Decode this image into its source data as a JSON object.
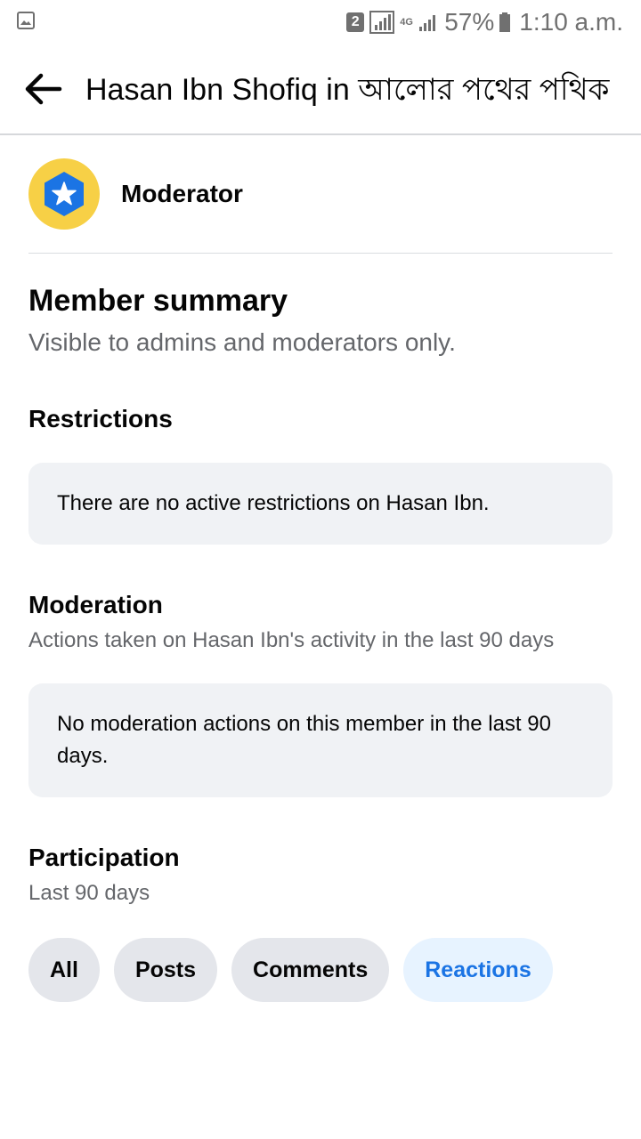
{
  "status_bar": {
    "sim_slot": "2",
    "network_type": "4G",
    "battery_percent": "57%",
    "time": "1:10 a.m."
  },
  "header": {
    "title": "Hasan Ibn Shofiq in আলোর পথের পথিক"
  },
  "role": {
    "label": "Moderator",
    "badge_color": "#f7d046",
    "badge_icon_color": "#1b74e4"
  },
  "summary": {
    "title": "Member summary",
    "subtitle": "Visible to admins and moderators only."
  },
  "restrictions": {
    "title": "Restrictions",
    "message": "There are no active restrictions on Hasan Ibn."
  },
  "moderation": {
    "title": "Moderation",
    "subtitle": "Actions taken on Hasan Ibn's activity in the last 90 days",
    "message": "No moderation actions on this member in the last 90 days."
  },
  "participation": {
    "title": "Participation",
    "subtitle": "Last 90 days",
    "filters": [
      "All",
      "Posts",
      "Comments",
      "Reactions"
    ],
    "active_filter": "Reactions"
  },
  "colors": {
    "accent": "#1b74e4",
    "card_bg": "#f0f2f5",
    "secondary_text": "#65676b"
  }
}
